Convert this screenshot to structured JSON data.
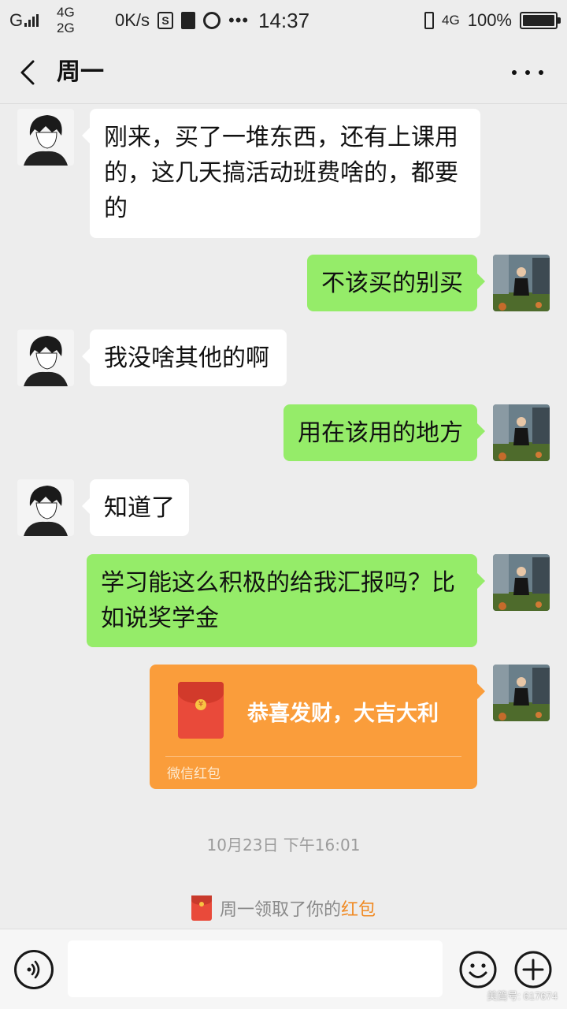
{
  "status_bar": {
    "carrier": "G",
    "net_top": "4G",
    "net_bottom": "2G",
    "speed": "0K/s",
    "time": "14:37",
    "net_right": "4G",
    "battery_label": "100%",
    "battery_level": 1.0
  },
  "header": {
    "title": "周一",
    "back_icon": "chevron-left-icon",
    "more_icon": "more-dots-icon"
  },
  "messages": [
    {
      "side": "left",
      "text": "刚来，买了一堆东西，还有上课用的，这几天搞活动班费啥的，都要的"
    },
    {
      "side": "right",
      "text": "不该买的别买"
    },
    {
      "side": "left",
      "text": "我没啥其他的啊"
    },
    {
      "side": "right",
      "text": "用在该用的地方"
    },
    {
      "side": "left",
      "text": "知道了"
    },
    {
      "side": "right",
      "text": "学习能这么积极的给我汇报吗？比如说奖学金"
    }
  ],
  "red_packet": {
    "title": "恭喜发财，大吉大利",
    "footer": "微信红包",
    "coin_symbol": "¥",
    "color": "#fa9d3b"
  },
  "timestamp": "10月23日 下午16:01",
  "notice": {
    "text": "周一领取了你的",
    "link": "红包"
  },
  "input_bar": {
    "voice_icon": "voice-icon",
    "emoji_icon": "emoji-icon",
    "plus_icon": "plus-icon",
    "input_value": ""
  },
  "watermark": "美篇号: 617674",
  "colors": {
    "sent_bubble": "#95ec69",
    "received_bubble": "#ffffff",
    "background": "#ededed",
    "red_packet_link": "#f08a24"
  }
}
